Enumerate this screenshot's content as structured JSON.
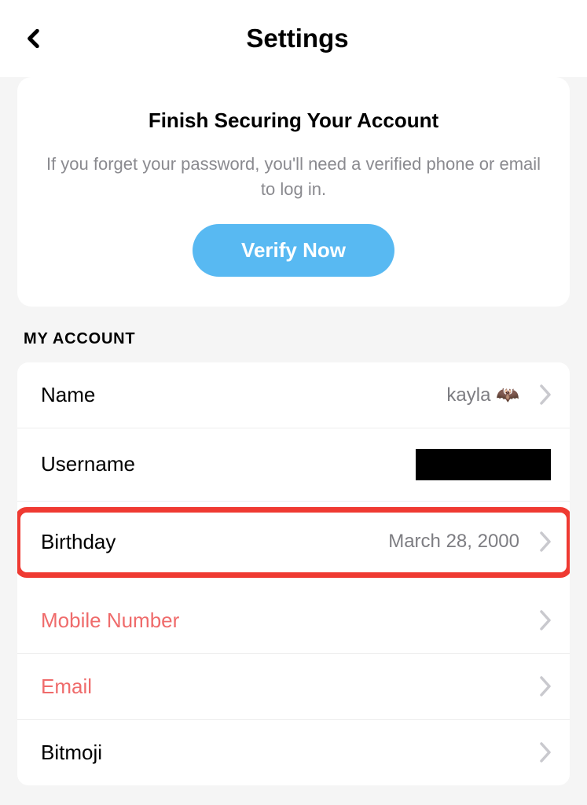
{
  "header": {
    "title": "Settings",
    "backIcon": "chevron-left"
  },
  "secureCard": {
    "title": "Finish Securing Your Account",
    "description": "If you forget your password, you'll need a verified phone or email to log in.",
    "buttonLabel": "Verify Now"
  },
  "section": {
    "title": "MY ACCOUNT"
  },
  "items": {
    "name": {
      "label": "Name",
      "value": "kayla 🦇"
    },
    "username": {
      "label": "Username"
    },
    "birthday": {
      "label": "Birthday",
      "value": "March 28, 2000"
    },
    "mobile": {
      "label": "Mobile Number"
    },
    "email": {
      "label": "Email"
    },
    "bitmoji": {
      "label": "Bitmoji"
    }
  }
}
